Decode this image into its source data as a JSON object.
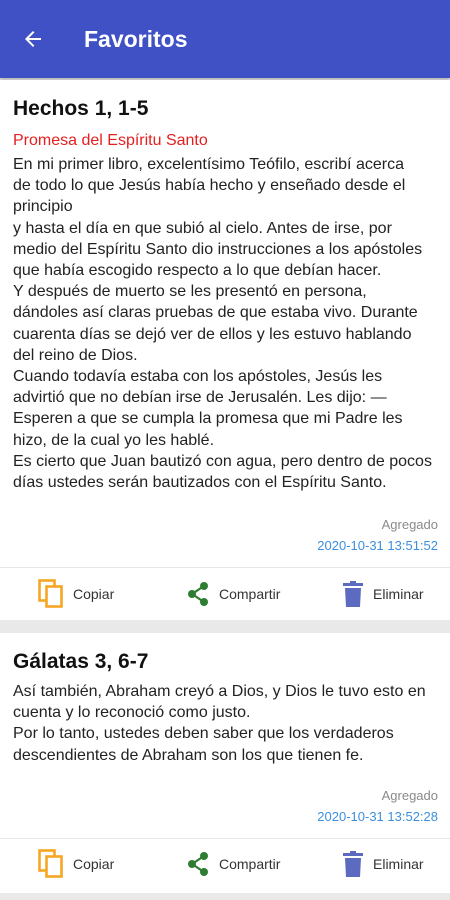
{
  "header": {
    "title": "Favoritos",
    "back_icon": "arrow-left-icon"
  },
  "actions": {
    "copy_label": "Copiar",
    "share_label": "Compartir",
    "delete_label": "Eliminar",
    "copy_icon": "copy-icon",
    "share_icon": "share-icon",
    "delete_icon": "trash-icon"
  },
  "favorites": [
    {
      "reference": "Hechos 1, 1-5",
      "subtitle": "Promesa del Espíritu Santo",
      "text": "En mi primer libro, excelentísimo Teófilo, escribí acerca\nde todo lo que Jesús había hecho y enseñado desde el\nprincipio\ny hasta el día en que subió al cielo. Antes de irse, por\nmedio del Espíritu Santo dio instrucciones a los apóstoles\nque había escogido respecto a lo que debían hacer.\nY después de muerto se les presentó en persona,\ndándoles así claras pruebas de que estaba vivo. Durante\ncuarenta días se dejó ver de ellos y les estuvo hablando\ndel reino de Dios.\nCuando todavía estaba con los apóstoles, Jesús les\nadvirtió que no debían irse de Jerusalén. Les dijo: —\nEsperen a que se cumpla la promesa que mi Padre les\nhizo, de la cual yo les hablé.\nEs cierto que Juan bautizó con agua, pero dentro de pocos\ndías ustedes serán bautizados con el Espíritu Santo.",
      "added_label": "Agregado",
      "added_date": "2020-10-31 13:51:52"
    },
    {
      "reference": "Gálatas 3, 6-7",
      "text": "Así también, Abraham creyó a Dios, y Dios le tuvo esto en\ncuenta y lo reconoció como justo.\nPor lo tanto, ustedes deben saber que los verdaderos\ndescendientes de Abraham son los que tienen fe.",
      "added_label": "Agregado",
      "added_date": "2020-10-31 13:52:28"
    }
  ],
  "colors": {
    "appbar": "#3f51c5",
    "subtitle_red": "#e41f1f",
    "date_blue": "#3d8fdc",
    "copy_orange": "#f5a623",
    "share_green": "#2e7d32",
    "delete_indigo": "#5c6bc0"
  }
}
